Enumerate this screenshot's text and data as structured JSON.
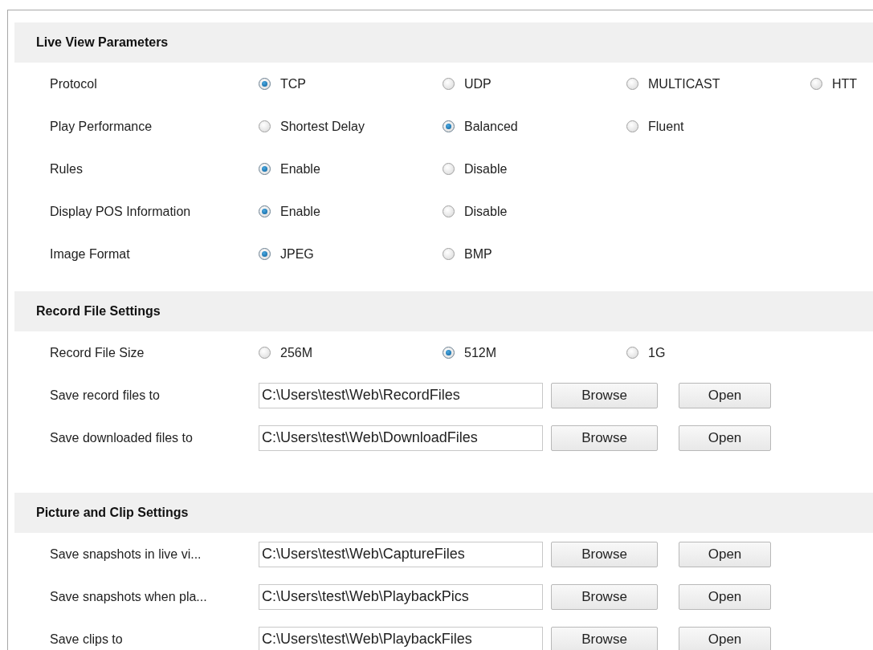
{
  "sections": [
    {
      "title": "Live View Parameters",
      "rows": [
        {
          "kind": "radio",
          "label": "Protocol",
          "options": [
            {
              "label": "TCP",
              "selected": true
            },
            {
              "label": "UDP",
              "selected": false
            },
            {
              "label": "MULTICAST",
              "selected": false
            },
            {
              "label": "HTT",
              "selected": false
            }
          ]
        },
        {
          "kind": "radio",
          "label": "Play Performance",
          "options": [
            {
              "label": "Shortest Delay",
              "selected": false
            },
            {
              "label": "Balanced",
              "selected": true
            },
            {
              "label": "Fluent",
              "selected": false
            }
          ]
        },
        {
          "kind": "radio",
          "label": "Rules",
          "options": [
            {
              "label": "Enable",
              "selected": true
            },
            {
              "label": "Disable",
              "selected": false
            }
          ]
        },
        {
          "kind": "radio",
          "label": "Display POS Information",
          "options": [
            {
              "label": "Enable",
              "selected": true
            },
            {
              "label": "Disable",
              "selected": false
            }
          ]
        },
        {
          "kind": "radio",
          "label": "Image Format",
          "options": [
            {
              "label": "JPEG",
              "selected": true
            },
            {
              "label": "BMP",
              "selected": false
            }
          ]
        }
      ]
    },
    {
      "title": "Record File Settings",
      "rows": [
        {
          "kind": "radio",
          "label": "Record File Size",
          "options": [
            {
              "label": "256M",
              "selected": false
            },
            {
              "label": "512M",
              "selected": true
            },
            {
              "label": "1G",
              "selected": false
            }
          ]
        },
        {
          "kind": "path",
          "label": "Save record files to",
          "value": "C:\\Users\\test\\Web\\RecordFiles",
          "buttons": [
            "Browse",
            "Open"
          ]
        },
        {
          "kind": "path",
          "label": "Save downloaded files to",
          "value": "C:\\Users\\test\\Web\\DownloadFiles",
          "buttons": [
            "Browse",
            "Open"
          ]
        }
      ]
    },
    {
      "title": "Picture and Clip Settings",
      "rows": [
        {
          "kind": "path",
          "label": "Save snapshots in live vi...",
          "value": "C:\\Users\\test\\Web\\CaptureFiles",
          "buttons": [
            "Browse",
            "Open"
          ]
        },
        {
          "kind": "path",
          "label": "Save snapshots when pla...",
          "value": "C:\\Users\\test\\Web\\PlaybackPics",
          "buttons": [
            "Browse",
            "Open"
          ]
        },
        {
          "kind": "path",
          "label": "Save clips to",
          "value": "C:\\Users\\test\\Web\\PlaybackFiles",
          "buttons": [
            "Browse",
            "Open"
          ]
        }
      ]
    }
  ]
}
